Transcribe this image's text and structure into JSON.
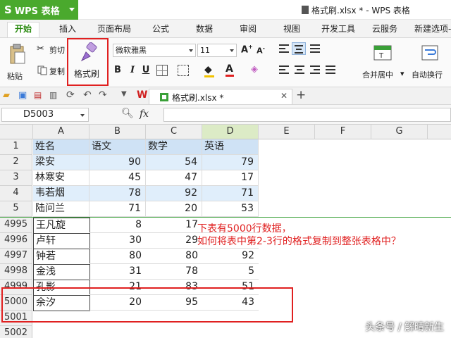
{
  "titlebar": {
    "app_name": "WPS 表格",
    "app_logo": "S",
    "doc_title": "格式刷.xlsx * - WPS 表格"
  },
  "menu": {
    "tabs": [
      {
        "label": "开始",
        "active": true
      },
      {
        "label": "插入"
      },
      {
        "label": "页面布局"
      },
      {
        "label": "公式"
      },
      {
        "label": "数据"
      },
      {
        "label": "审阅"
      },
      {
        "label": "视图"
      },
      {
        "label": "开发工具"
      },
      {
        "label": "云服务"
      },
      {
        "label": "新建选项-"
      }
    ]
  },
  "ribbon": {
    "paste": "粘贴",
    "cut": "剪切",
    "copy": "复制",
    "format_painter": "格式刷",
    "font_name": "微软雅黑",
    "font_size": "11",
    "bold": "B",
    "italic": "I",
    "underline": "U",
    "merge_center": "合并居中",
    "wrap_text": "自动换行"
  },
  "quickbar": {
    "doc_tab": "格式刷.xlsx *",
    "new_tab": "+"
  },
  "formula": {
    "name_box": "D5003",
    "fx": "fx",
    "content": ""
  },
  "columns": [
    "A",
    "B",
    "C",
    "D",
    "E",
    "F",
    "G"
  ],
  "top_rows": [
    {
      "num": "1",
      "cells": [
        "姓名",
        "语文",
        "数学",
        "英语"
      ]
    },
    {
      "num": "2",
      "cells": [
        "梁安",
        "90",
        "54",
        "79"
      ]
    },
    {
      "num": "3",
      "cells": [
        "林寒安",
        "45",
        "47",
        "17"
      ]
    },
    {
      "num": "4",
      "cells": [
        "韦若烟",
        "78",
        "92",
        "71"
      ]
    },
    {
      "num": "5",
      "cells": [
        "陆问兰",
        "71",
        "20",
        "53"
      ]
    }
  ],
  "bottom_rows": [
    {
      "num": "4995",
      "cells": [
        "王凡旋",
        "8",
        "17",
        ""
      ]
    },
    {
      "num": "4996",
      "cells": [
        "卢轩",
        "30",
        "29",
        ""
      ]
    },
    {
      "num": "4997",
      "cells": [
        "钟若",
        "80",
        "80",
        "92"
      ]
    },
    {
      "num": "4998",
      "cells": [
        "金浅",
        "31",
        "78",
        "5"
      ]
    },
    {
      "num": "4999",
      "cells": [
        "孔影",
        "21",
        "83",
        "51"
      ]
    },
    {
      "num": "5000",
      "cells": [
        "余汐",
        "20",
        "95",
        "43"
      ]
    },
    {
      "num": "5001",
      "cells": [
        "",
        "",
        "",
        ""
      ]
    },
    {
      "num": "5002",
      "cells": [
        "",
        "",
        "",
        ""
      ]
    }
  ],
  "annotation": {
    "line1": "下表有5000行数据，",
    "line2": "如何将表中第2-3行的格式复制到整张表格中？"
  },
  "watermark": "头条号 / 解晴新生",
  "colors": {
    "accent_green": "#4aa92d",
    "header_fill": "#cfe2f5",
    "band_fill": "#e0eefb",
    "highlight_red": "#e02020"
  }
}
